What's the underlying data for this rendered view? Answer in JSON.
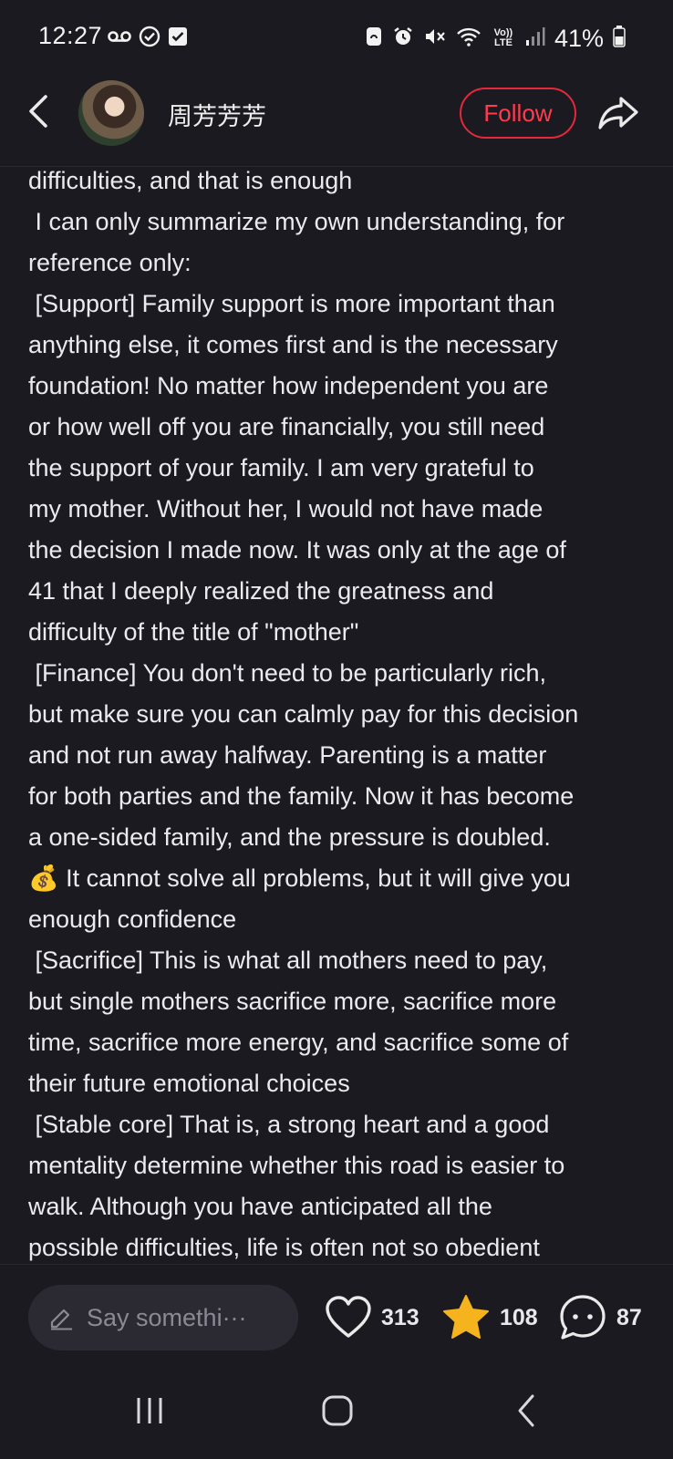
{
  "status_bar": {
    "time": "12:27",
    "battery": "41%",
    "left_icons": [
      "voicemail-icon",
      "check-circle-icon",
      "checkbox-icon"
    ],
    "right_icons": [
      "lock-icon",
      "alarm-icon",
      "mute-icon",
      "wifi-icon",
      "volte-icon",
      "signal-icon",
      "battery-icon"
    ],
    "volte_label": "Vo)) LTE"
  },
  "header": {
    "username": "周芳芳芳",
    "follow_label": "Follow",
    "accent": "#e5283d"
  },
  "post": {
    "lines": [
      "difficulties, and that is enough",
      " I can only summarize my own understanding, for",
      "reference only:",
      " [Support] Family support is more important than",
      "anything else, it comes first and is the necessary",
      "foundation! No matter how independent you are",
      "or how well off you are financially, you still need",
      "the support of your family. I am very grateful to",
      "my mother. Without her, I would not have made",
      "the decision I made now. It was only at the age of",
      "41 that I deeply realized the greatness and",
      "difficulty of the title of \"mother\"",
      " [Finance] You don't need to be particularly rich,",
      "but make sure you can calmly pay for this decision",
      "and not run away halfway. Parenting is a matter",
      "for both parties and the family. Now it has become",
      "a one-sided family, and the pressure is doubled.",
      "💰 It cannot solve all problems, but it will give you",
      "enough confidence",
      " [Sacrifice] This is what all mothers need to pay,",
      "but single mothers sacrifice more, sacrifice more",
      "time, sacrifice more energy, and sacrifice some of",
      "their future emotional choices",
      " [Stable core] That is, a strong heart and a good",
      "mentality determine whether this road is easier to",
      "walk. Although you have anticipated all the",
      "possible difficulties, life is often not so obedient"
    ]
  },
  "bottom_bar": {
    "comment_placeholder": "Say somethi···",
    "likes": "313",
    "favorites": "108",
    "comments": "87",
    "star_color": "#f5b31d"
  },
  "nav": {
    "icons": [
      "recent-apps-icon",
      "home-icon",
      "back-icon"
    ]
  }
}
